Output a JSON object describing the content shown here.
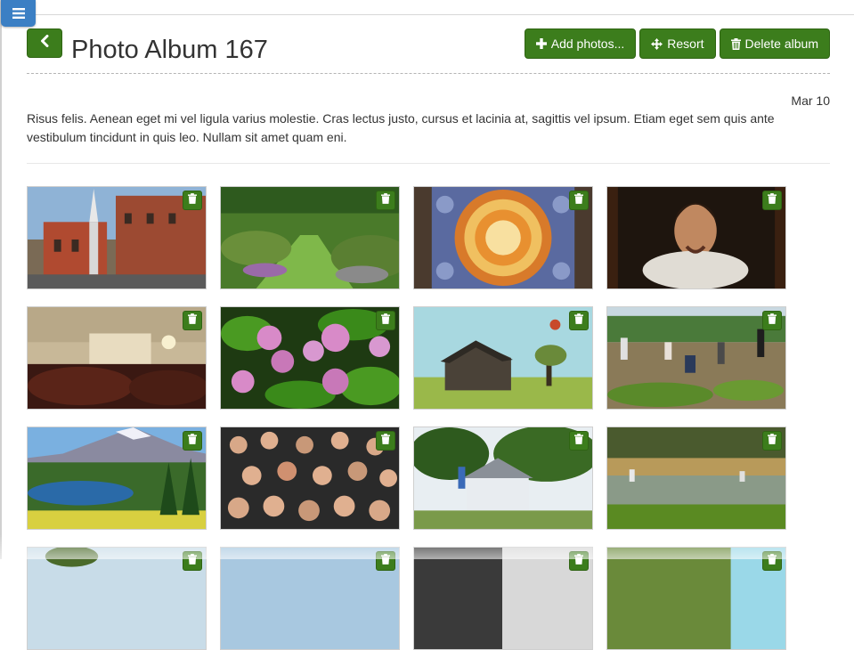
{
  "album": {
    "title": "Photo Album 167",
    "date": "Mar 10",
    "description": "Risus felis. Aenean eget mi vel ligula varius molestie. Cras lectus justo, cursus et lacinia at, sagittis vel ipsum. Etiam eget sem quis ante vestibulum tincidunt in quis leo. Nullam sit amet quam eni."
  },
  "toolbar": {
    "add_label": "Add photos...",
    "resort_label": "Resort",
    "delete_label": "Delete album"
  },
  "icons": {
    "menu": "hamburger-icon",
    "back": "chevron-left-icon",
    "add": "plus-icon",
    "resort": "move-icon",
    "delete": "trash-icon",
    "photo_delete": "trash-icon"
  },
  "colors": {
    "accent_green": "#3c7d1c",
    "menu_blue": "#3b7fc4"
  },
  "photos": [
    {
      "subject": "church-street"
    },
    {
      "subject": "garden-path"
    },
    {
      "subject": "mandala-art"
    },
    {
      "subject": "portrait-painting"
    },
    {
      "subject": "church-interior"
    },
    {
      "subject": "water-lilies"
    },
    {
      "subject": "old-house-field"
    },
    {
      "subject": "gardeners-working"
    },
    {
      "subject": "mountain-lake"
    },
    {
      "subject": "crowd-waving"
    },
    {
      "subject": "victorian-house-trees"
    },
    {
      "subject": "creek-wetland"
    },
    {
      "subject": "partial-1"
    },
    {
      "subject": "partial-2"
    },
    {
      "subject": "partial-3"
    },
    {
      "subject": "partial-4"
    }
  ]
}
